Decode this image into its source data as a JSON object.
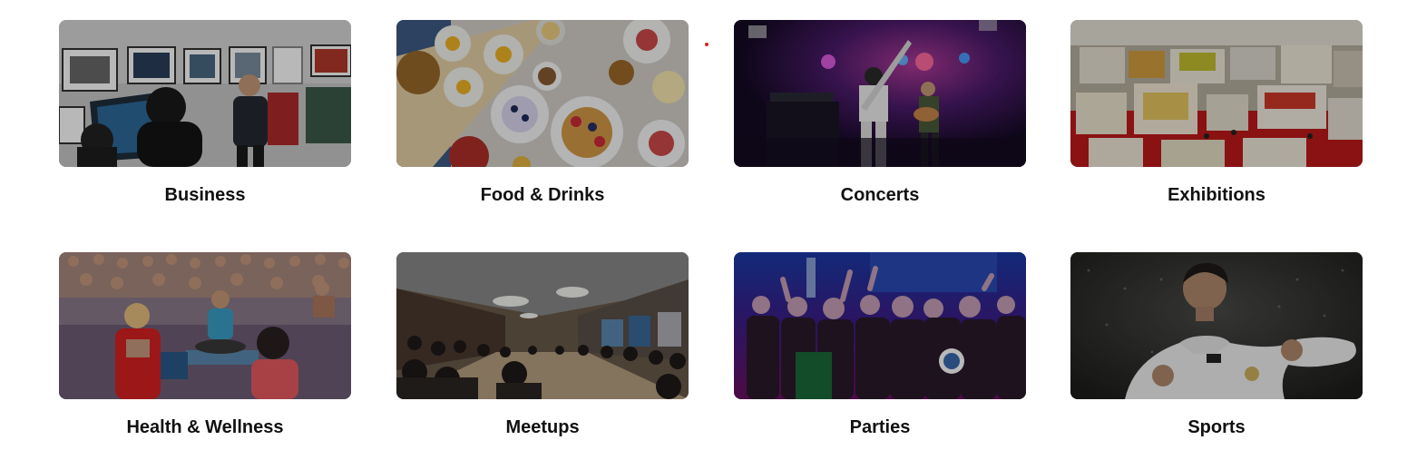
{
  "colors": {
    "label_text": "#111111",
    "accent_dot": "#e02020"
  },
  "categories": [
    {
      "label": "Business",
      "image": "business-photo"
    },
    {
      "label": "Food & Drinks",
      "image": "food-photo"
    },
    {
      "label": "Concerts",
      "image": "concert-photo"
    },
    {
      "label": "Exhibitions",
      "image": "exhibition-photo"
    },
    {
      "label": "Health & Wellness",
      "image": "yoga-photo"
    },
    {
      "label": "Meetups",
      "image": "meetup-photo"
    },
    {
      "label": "Parties",
      "image": "party-photo"
    },
    {
      "label": "Sports",
      "image": "sports-photo"
    }
  ]
}
